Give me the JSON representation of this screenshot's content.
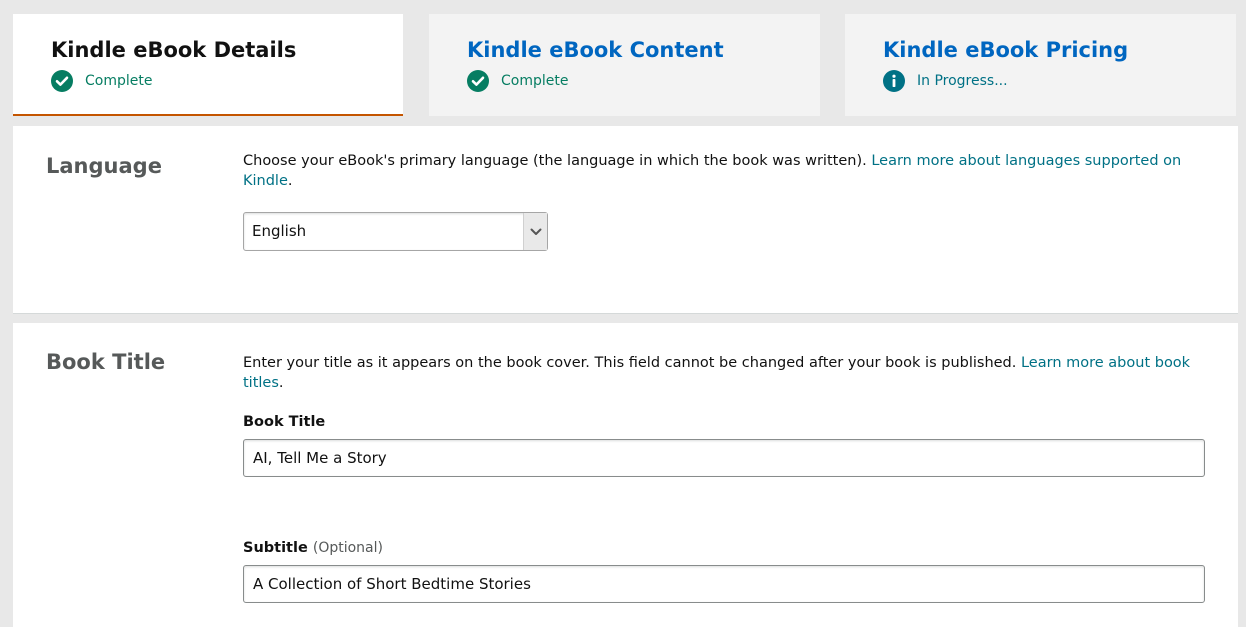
{
  "tabs": [
    {
      "title": "Kindle eBook Details",
      "status": "Complete",
      "status_icon": "check-circle-icon",
      "active": true
    },
    {
      "title": "Kindle eBook Content",
      "status": "Complete",
      "status_icon": "check-circle-icon",
      "active": false
    },
    {
      "title": "Kindle eBook Pricing",
      "status": "In Progress...",
      "status_icon": "info-circle-icon",
      "active": false
    }
  ],
  "language": {
    "heading": "Language",
    "description": "Choose your eBook's primary language (the language in which the book was written). ",
    "link": "Learn more about languages supported on Kindle",
    "after_link": ".",
    "selected": "English"
  },
  "book_title": {
    "heading": "Book Title",
    "description": "Enter your title as it appears on the book cover. This field cannot be changed after your book is published. ",
    "link": "Learn more about book titles",
    "after_link": ".",
    "title_label": "Book Title",
    "title_value": "AI, Tell Me a Story",
    "subtitle_label": "Subtitle",
    "subtitle_optional": "(Optional)",
    "subtitle_value": "A Collection of Short Bedtime Stories"
  },
  "colors": {
    "accent_active_tab": "#c45500",
    "link": "#007185",
    "tab_link": "#0066c0",
    "complete": "#067d62",
    "in_progress": "#007185"
  }
}
